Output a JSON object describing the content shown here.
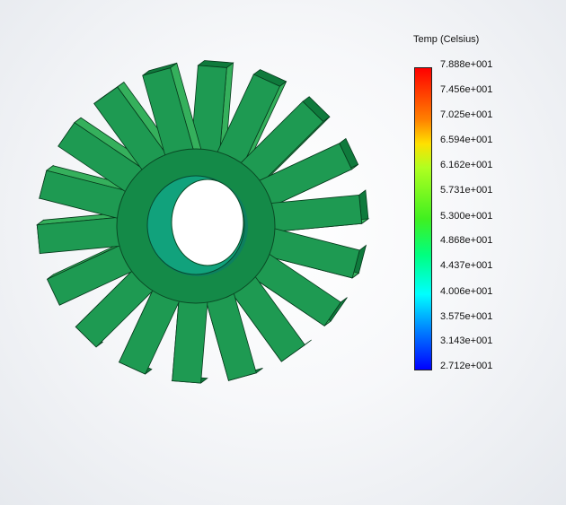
{
  "legend": {
    "title": "Temp (Celsius)",
    "ticks": [
      "7.888e+001",
      "7.456e+001",
      "7.025e+001",
      "6.594e+001",
      "6.162e+001",
      "5.731e+001",
      "5.300e+001",
      "4.868e+001",
      "4.437e+001",
      "4.006e+001",
      "3.575e+001",
      "3.143e+001",
      "2.712e+001"
    ],
    "colors": [
      "#ff0000",
      "#ff8000",
      "#ffe000",
      "#40f020",
      "#00ffff",
      "#0000ff"
    ]
  },
  "model": {
    "fin_color_top": "#35b05c",
    "fin_color_side": "#0f7a3c",
    "hub_color": "#148a48",
    "bore_color": "#12a07a",
    "fin_count": 18
  }
}
